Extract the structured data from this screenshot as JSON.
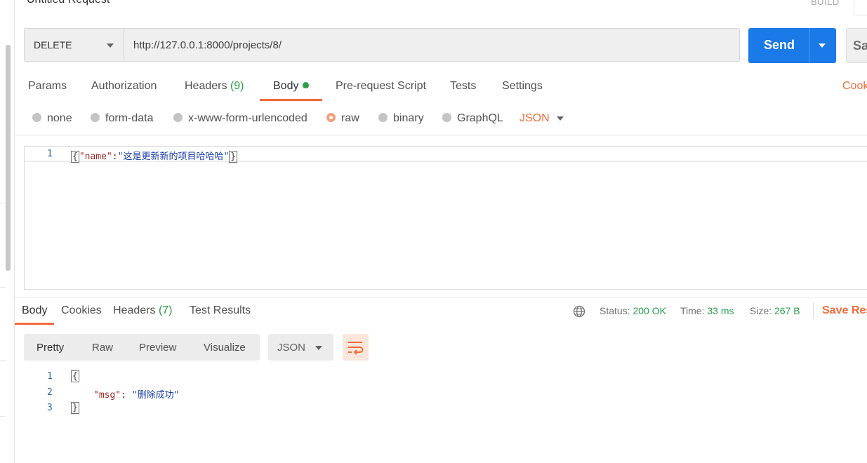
{
  "header": {
    "title": "Untitled Request",
    "build_label": "BUILD"
  },
  "request": {
    "method": "DELETE",
    "url": "http://127.0.0.1:8000/projects/8/",
    "send_label": "Send",
    "save_label": "Sa"
  },
  "request_tabs": {
    "params": "Params",
    "authorization": "Authorization",
    "headers": "Headers",
    "headers_count": "(9)",
    "body": "Body",
    "prerequest": "Pre-request Script",
    "tests": "Tests",
    "settings": "Settings",
    "cookies": "Cook"
  },
  "body_types": {
    "none": "none",
    "form_data": "form-data",
    "urlencoded": "x-www-form-urlencoded",
    "raw": "raw",
    "binary": "binary",
    "graphql": "GraphQL",
    "format": "JSON",
    "selected": "raw"
  },
  "request_body": {
    "line_no": "1",
    "open": "{",
    "key": "\"name\"",
    "colon": ":",
    "value": "\"这是更新新的项目哈哈哈\"",
    "close": "}"
  },
  "response_tabs": {
    "body": "Body",
    "cookies": "Cookies",
    "headers": "Headers",
    "headers_count": "(7)",
    "test_results": "Test Results"
  },
  "response_status": {
    "status_label": "Status:",
    "status_value": "200 OK",
    "time_label": "Time:",
    "time_value": "33 ms",
    "size_label": "Size:",
    "size_value": "267 B",
    "save_response": "Save Res"
  },
  "view_modes": {
    "pretty": "Pretty",
    "raw": "Raw",
    "preview": "Preview",
    "visualize": "Visualize",
    "format": "JSON"
  },
  "response_body": {
    "lines": [
      "1",
      "2",
      "3"
    ],
    "open": "{",
    "key": "\"msg\"",
    "colon": ": ",
    "value": "\"删除成功\"",
    "close": "}"
  },
  "colors": {
    "accent": "#f26b3a",
    "send": "#1a7ae8",
    "success": "#26a04b"
  }
}
